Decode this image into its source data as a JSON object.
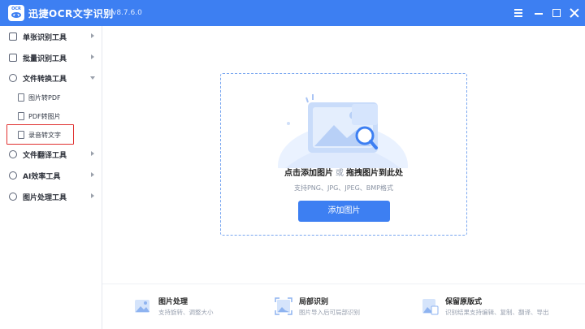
{
  "titlebar": {
    "logo_text": "OCR",
    "app_name": "迅捷OCR文字识别",
    "version": "v8.7.6.0"
  },
  "sidebar": {
    "items": [
      {
        "label": "单张识别工具",
        "icon": "single-doc-icon",
        "arrow": "right"
      },
      {
        "label": "批量识别工具",
        "icon": "batch-doc-icon",
        "arrow": "right"
      },
      {
        "label": "文件转换工具",
        "icon": "convert-icon",
        "arrow": "down"
      },
      {
        "label": "文件翻译工具",
        "icon": "translate-icon",
        "arrow": "right"
      },
      {
        "label": "AI效率工具",
        "icon": "ai-icon",
        "arrow": "right"
      },
      {
        "label": "图片处理工具",
        "icon": "image-process-icon",
        "arrow": "right"
      }
    ],
    "sub_items": [
      {
        "label": "图片转PDF",
        "icon": "pdf-icon"
      },
      {
        "label": "PDF转图片",
        "icon": "image-icon"
      },
      {
        "label": "录音转文字",
        "icon": "audio-text-icon"
      }
    ],
    "highlighted": "录音转文字"
  },
  "upload": {
    "main_a": "点击添加图片",
    "or": "或",
    "main_b": "拖拽图片到此处",
    "formats": "支持PNG、JPG、JPEG、BMP格式",
    "button": "添加图片"
  },
  "features": [
    {
      "title": "图片处理",
      "desc": "支持旋转、调整大小",
      "icon": "image-edit-icon"
    },
    {
      "title": "局部识别",
      "desc": "图片导入后可局部识别",
      "icon": "crop-scan-icon"
    },
    {
      "title": "保留原版式",
      "desc": "识别结果支持编辑、复制、翻译、导出",
      "icon": "layout-keep-icon"
    }
  ],
  "colors": {
    "accent": "#3d7ff2",
    "highlight_border": "#e0302f",
    "dropzone_border": "#7aa7f0"
  }
}
